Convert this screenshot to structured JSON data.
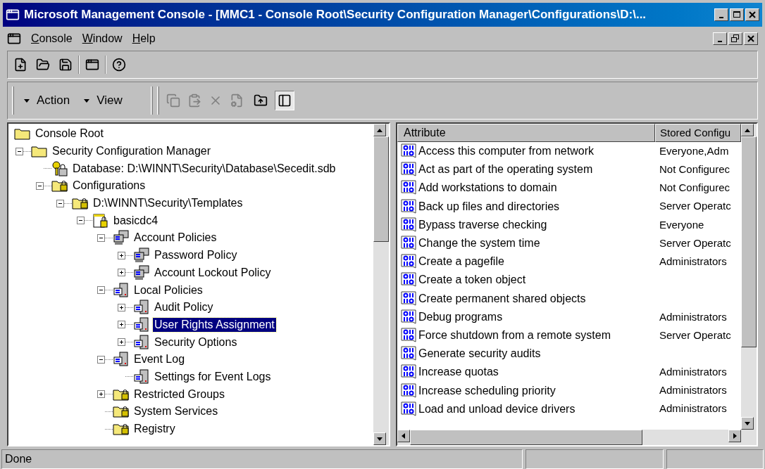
{
  "window": {
    "title": "Microsoft Management Console - [MMC1 - Console Root\\Security Configuration Manager\\Configurations\\D:\\..."
  },
  "menu": [
    "Console",
    "Window",
    "Help"
  ],
  "toolbar2": {
    "menus": [
      "Action",
      "View"
    ]
  },
  "tree": [
    {
      "label": "Console Root",
      "kind": "folder",
      "selected": false,
      "children": [
        {
          "label": "Security Configuration Manager",
          "kind": "folder",
          "expanded": true,
          "selected": false,
          "children": [
            {
              "label": "Database: D:\\WINNT\\Security\\Database\\Secedit.sdb",
              "kind": "database",
              "selected": false
            },
            {
              "label": "Configurations",
              "kind": "lock-folder",
              "expanded": true,
              "selected": false,
              "children": [
                {
                  "label": "D:\\WINNT\\Security\\Templates",
                  "kind": "lock-folder",
                  "expanded": true,
                  "selected": false,
                  "children": [
                    {
                      "label": "basicdc4",
                      "kind": "template",
                      "expanded": true,
                      "selected": false,
                      "children": [
                        {
                          "label": "Account Policies",
                          "kind": "computers",
                          "expanded": true,
                          "selected": false,
                          "children": [
                            {
                              "label": "Password Policy",
                              "kind": "computers",
                              "expanded": false,
                              "selected": false
                            },
                            {
                              "label": "Account Lockout Policy",
                              "kind": "computers",
                              "expanded": false,
                              "selected": false
                            }
                          ]
                        },
                        {
                          "label": "Local Policies",
                          "kind": "server",
                          "expanded": true,
                          "selected": false,
                          "children": [
                            {
                              "label": "Audit Policy",
                              "kind": "server",
                              "expanded": false,
                              "selected": false
                            },
                            {
                              "label": "User Rights Assignment",
                              "kind": "server",
                              "expanded": false,
                              "selected": true
                            },
                            {
                              "label": "Security Options",
                              "kind": "server",
                              "expanded": false,
                              "selected": false
                            }
                          ]
                        },
                        {
                          "label": "Event Log",
                          "kind": "server",
                          "expanded": true,
                          "selected": false,
                          "children": [
                            {
                              "label": "Settings for Event Logs",
                              "kind": "server",
                              "selected": false
                            }
                          ]
                        },
                        {
                          "label": "Restricted Groups",
                          "kind": "lock-folder",
                          "expanded": false,
                          "selected": false
                        },
                        {
                          "label": "System Services",
                          "kind": "lock-folder",
                          "selected": false
                        },
                        {
                          "label": "Registry",
                          "kind": "lock-folder",
                          "selected": false
                        }
                      ]
                    }
                  ]
                }
              ]
            }
          ]
        }
      ]
    }
  ],
  "table": {
    "columns": [
      "Attribute",
      "Stored Configu"
    ],
    "rows": [
      {
        "attribute": "Access this computer from network",
        "stored": "Everyone,Adm"
      },
      {
        "attribute": "Act as part of the operating system",
        "stored": "Not Configurec"
      },
      {
        "attribute": "Add workstations to domain",
        "stored": "Not Configurec"
      },
      {
        "attribute": "Back up files and directories",
        "stored": "Server Operatc"
      },
      {
        "attribute": "Bypass traverse checking",
        "stored": "Everyone"
      },
      {
        "attribute": "Change the system time",
        "stored": "Server Operatc"
      },
      {
        "attribute": "Create a pagefile",
        "stored": "Administrators"
      },
      {
        "attribute": "Create a token object"
      },
      {
        "attribute": "Create permanent shared objects"
      },
      {
        "attribute": "Debug programs",
        "stored": "Administrators"
      },
      {
        "attribute": "Force shutdown from a remote system",
        "stored": "Server Operatc"
      },
      {
        "attribute": "Generate security audits"
      },
      {
        "attribute": "Increase quotas",
        "stored": "Administrators"
      },
      {
        "attribute": "Increase scheduling priority",
        "stored": "Administrators"
      },
      {
        "attribute": "Load and unload device drivers",
        "stored": "Administrators"
      }
    ]
  },
  "status_bar": {
    "text": "Done"
  }
}
